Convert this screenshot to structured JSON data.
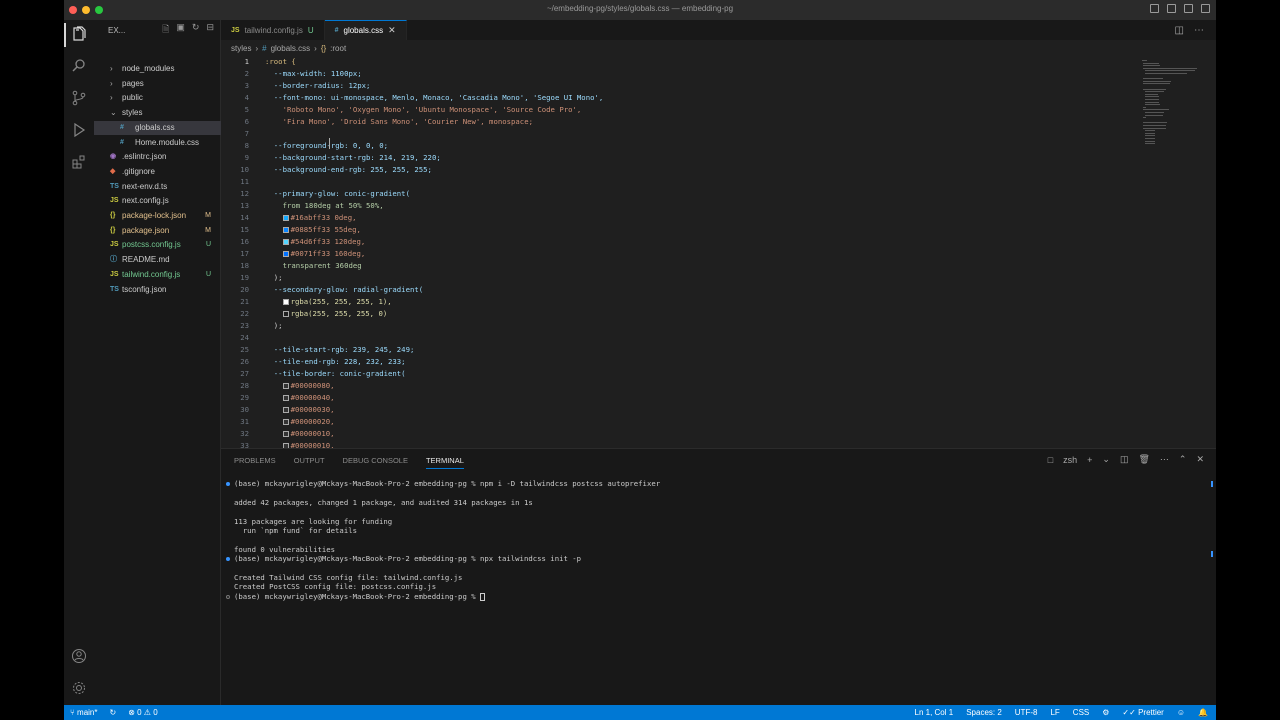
{
  "window": {
    "title": "~/embedding-pg/styles/globals.css — embedding-pg"
  },
  "sidebar": {
    "title": "EX...",
    "items": [
      {
        "label": "node_modules",
        "type": "folder",
        "badge": ""
      },
      {
        "label": "pages",
        "type": "folder",
        "badge": ""
      },
      {
        "label": "public",
        "type": "folder",
        "badge": ""
      },
      {
        "label": "styles",
        "type": "folder-open",
        "badge": ""
      },
      {
        "label": "globals.css",
        "type": "css",
        "badge": ""
      },
      {
        "label": "Home.module.css",
        "type": "css",
        "badge": ""
      },
      {
        "label": ".eslintrc.json",
        "type": "eslint",
        "badge": ""
      },
      {
        "label": ".gitignore",
        "type": "git",
        "badge": ""
      },
      {
        "label": "next-env.d.ts",
        "type": "ts",
        "badge": ""
      },
      {
        "label": "next.config.js",
        "type": "js",
        "badge": ""
      },
      {
        "label": "package-lock.json",
        "type": "json",
        "badge": "M"
      },
      {
        "label": "package.json",
        "type": "json",
        "badge": "M"
      },
      {
        "label": "postcss.config.js",
        "type": "js",
        "badge": "U"
      },
      {
        "label": "README.md",
        "type": "md",
        "badge": ""
      },
      {
        "label": "tailwind.config.js",
        "type": "js",
        "badge": "U"
      },
      {
        "label": "tsconfig.json",
        "type": "ts",
        "badge": ""
      }
    ]
  },
  "tabs": [
    {
      "icon": "JS",
      "label": "tailwind.config.js",
      "status": "U"
    },
    {
      "icon": "#",
      "label": "globals.css",
      "status": ""
    }
  ],
  "breadcrumb": {
    "folder": "styles",
    "file": "globals.css",
    "symbol": ":root"
  },
  "editor": {
    "lines": [
      ":root {",
      "  --max-width: 1100px;",
      "  --border-radius: 12px;",
      "  --font-mono: ui-monospace, Menlo, Monaco, 'Cascadia Mono', 'Segoe UI Mono',",
      "    'Roboto Mono', 'Oxygen Mono', 'Ubuntu Monospace', 'Source Code Pro',",
      "    'Fira Mono', 'Droid Sans Mono', 'Courier New', monospace;",
      "",
      "  --foreground-rgb: 0, 0, 0;",
      "  --background-start-rgb: 214, 219, 220;",
      "  --background-end-rgb: 255, 255, 255;",
      "",
      "  --primary-glow: conic-gradient(",
      "    from 180deg at 50% 50%,",
      "    #16abff33 0deg,",
      "    #0885ff33 55deg,",
      "    #54d6ff33 120deg,",
      "    #0071ff33 160deg,",
      "    transparent 360deg",
      "  );",
      "  --secondary-glow: radial-gradient(",
      "    rgba(255, 255, 255, 1),",
      "    rgba(255, 255, 255, 0)",
      "  );",
      "",
      "  --tile-start-rgb: 239, 245, 249;",
      "  --tile-end-rgb: 228, 232, 233;",
      "  --tile-border: conic-gradient(",
      "    #00000080,",
      "    #00000040,",
      "    #00000030,",
      "    #00000020,",
      "    #00000010,",
      "    #00000010,"
    ]
  },
  "panel": {
    "tabs": [
      "PROBLEMS",
      "OUTPUT",
      "DEBUG CONSOLE",
      "TERMINAL"
    ],
    "shell": "zsh",
    "terminal_lines": [
      "(base) mckaywrigley@Mckays-MacBook-Pro-2 embedding-pg % npm i -D tailwindcss postcss autoprefixer",
      "",
      "added 42 packages, changed 1 package, and audited 314 packages in 1s",
      "",
      "113 packages are looking for funding",
      "  run `npm fund` for details",
      "",
      "found 0 vulnerabilities",
      "(base) mckaywrigley@Mckays-MacBook-Pro-2 embedding-pg % npx tailwindcss init -p",
      "",
      "Created Tailwind CSS config file: tailwind.config.js",
      "Created PostCSS config file: postcss.config.js",
      "(base) mckaywrigley@Mckays-MacBook-Pro-2 embedding-pg % "
    ]
  },
  "statusbar": {
    "branch": "main*",
    "problems": "0",
    "warnings": "0",
    "position": "Ln 1, Col 1",
    "spaces": "Spaces: 2",
    "encoding": "UTF-8",
    "eol": "LF",
    "language": "CSS",
    "formatter": "Prettier"
  },
  "colors": {
    "accent": "#0078d4",
    "statusbar": "#0078d4"
  }
}
